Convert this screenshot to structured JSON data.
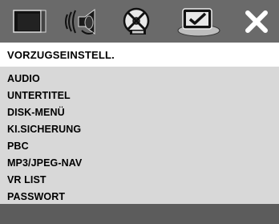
{
  "toolbar": {
    "icons": [
      "display-icon",
      "audio-speaker-icon",
      "disc-icon",
      "preferences-icon",
      "exit-x-icon"
    ]
  },
  "panel": {
    "title": "VORZUGSEINSTELL."
  },
  "menu": {
    "items": [
      "AUDIO",
      "UNTERTITEL",
      "DISK-MENÜ",
      "KI.SICHERUNG",
      "PBC",
      "MP3/JPEG-NAV",
      "VR LIST",
      "PASSWORT"
    ]
  }
}
